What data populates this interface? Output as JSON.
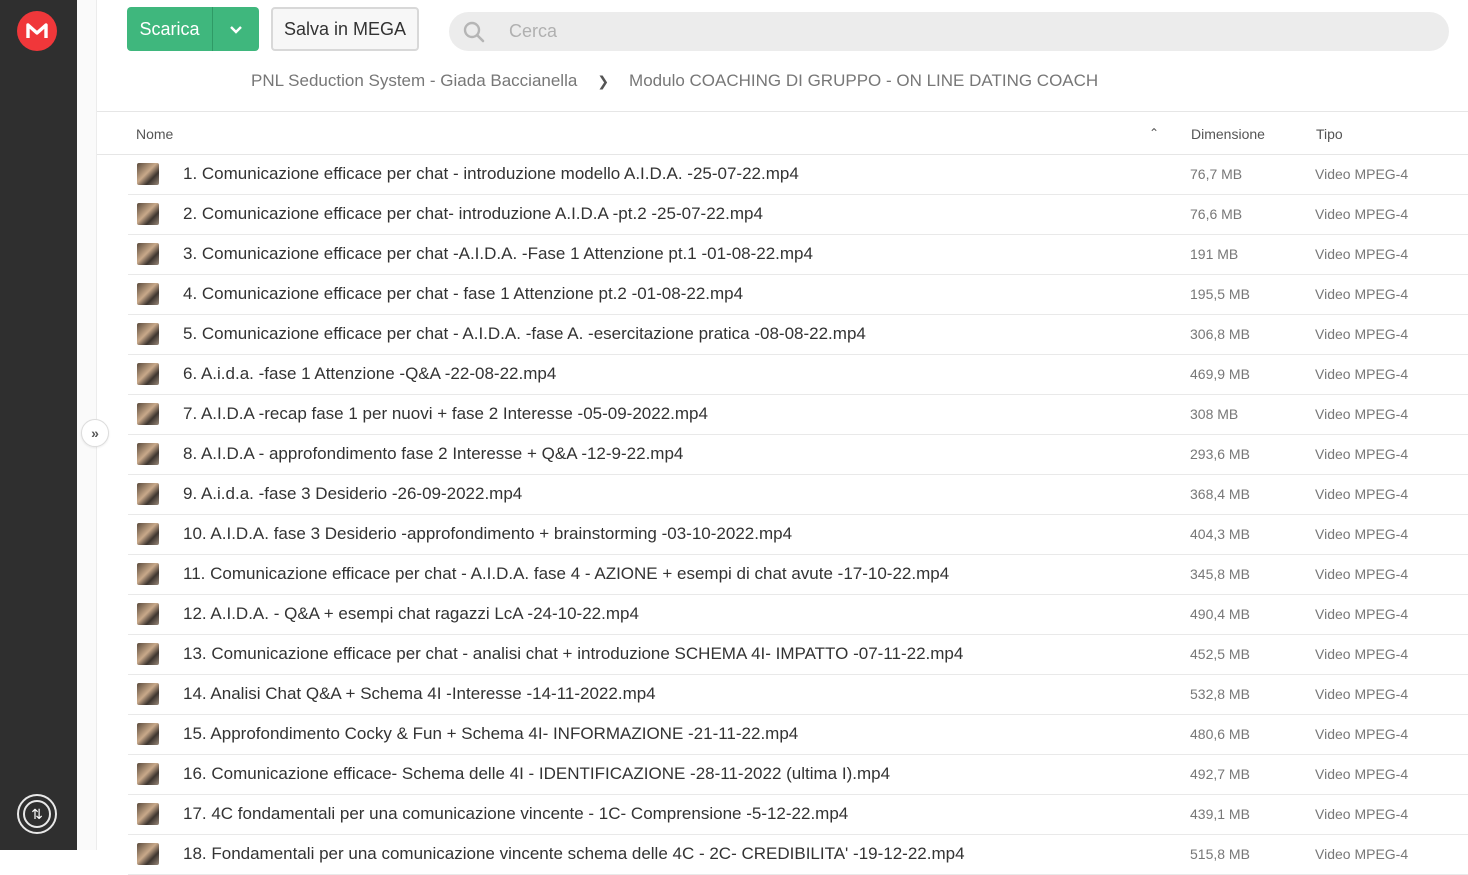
{
  "colors": {
    "accent": "#3fb77d",
    "brand": "#f0373a",
    "sidebar": "#2f2f2f"
  },
  "toolbar": {
    "download_label": "Scarica",
    "save_label": "Salva in MEGA",
    "search_placeholder": "Cerca"
  },
  "breadcrumb": {
    "parent": "PNL Seduction System - Giada Baccianella",
    "current": "Modulo COACHING DI GRUPPO - ON LINE DATING COACH"
  },
  "table": {
    "headers": {
      "name": "Nome",
      "size": "Dimensione",
      "type": "Tipo"
    },
    "rows": [
      {
        "name": "1. Comunicazione efficace per chat - introduzione modello A.I.D.A. -25-07-22.mp4",
        "size": "76,7 MB",
        "type": "Video MPEG-4"
      },
      {
        "name": "2. Comunicazione efficace per chat- introduzione A.I.D.A -pt.2 -25-07-22.mp4",
        "size": "76,6 MB",
        "type": "Video MPEG-4"
      },
      {
        "name": "3. Comunicazione efficace per chat -A.I.D.A. -Fase 1 Attenzione pt.1 -01-08-22.mp4",
        "size": "191 MB",
        "type": "Video MPEG-4"
      },
      {
        "name": "4. Comunicazione efficace per chat - fase 1 Attenzione pt.2 -01-08-22.mp4",
        "size": "195,5 MB",
        "type": "Video MPEG-4"
      },
      {
        "name": "5. Comunicazione efficace per chat - A.I.D.A. -fase A. -esercitazione pratica -08-08-22.mp4",
        "size": "306,8 MB",
        "type": "Video MPEG-4"
      },
      {
        "name": "6. A.i.d.a. -fase 1 Attenzione -Q&A -22-08-22.mp4",
        "size": "469,9 MB",
        "type": "Video MPEG-4"
      },
      {
        "name": "7. A.I.D.A -recap fase 1 per nuovi + fase 2 Interesse -05-09-2022.mp4",
        "size": "308 MB",
        "type": "Video MPEG-4"
      },
      {
        "name": "8. A.I.D.A - approfondimento fase 2 Interesse + Q&A -12-9-22.mp4",
        "size": "293,6 MB",
        "type": "Video MPEG-4"
      },
      {
        "name": "9. A.i.d.a. -fase 3 Desiderio -26-09-2022.mp4",
        "size": "368,4 MB",
        "type": "Video MPEG-4"
      },
      {
        "name": "10. A.I.D.A. fase 3 Desiderio -approfondimento + brainstorming -03-10-2022.mp4",
        "size": "404,3 MB",
        "type": "Video MPEG-4"
      },
      {
        "name": "11. Comunicazione efficace per chat - A.I.D.A. fase 4 - AZIONE + esempi di chat avute -17-10-22.mp4",
        "size": "345,8 MB",
        "type": "Video MPEG-4"
      },
      {
        "name": "12. A.I.D.A. - Q&A + esempi chat ragazzi LcA -24-10-22.mp4",
        "size": "490,4 MB",
        "type": "Video MPEG-4"
      },
      {
        "name": "13. Comunicazione efficace per chat - analisi chat + introduzione SCHEMA 4I- IMPATTO -07-11-22.mp4",
        "size": "452,5 MB",
        "type": "Video MPEG-4"
      },
      {
        "name": "14. Analisi Chat Q&A + Schema 4I -Interesse -14-11-2022.mp4",
        "size": "532,8 MB",
        "type": "Video MPEG-4"
      },
      {
        "name": "15. Approfondimento Cocky & Fun + Schema 4I- INFORMAZIONE -21-11-22.mp4",
        "size": "480,6 MB",
        "type": "Video MPEG-4"
      },
      {
        "name": "16. Comunicazione efficace- Schema delle 4I - IDENTIFICAZIONE -28-11-2022 (ultima I).mp4",
        "size": "492,7 MB",
        "type": "Video MPEG-4"
      },
      {
        "name": "17. 4C fondamentali per una comunicazione vincente - 1C- Comprensione -5-12-22.mp4",
        "size": "439,1 MB",
        "type": "Video MPEG-4"
      },
      {
        "name": "18. Fondamentali per una comunicazione vincente schema delle 4C - 2C- CREDIBILITA' -19-12-22.mp4",
        "size": "515,8 MB",
        "type": "Video MPEG-4"
      }
    ]
  }
}
